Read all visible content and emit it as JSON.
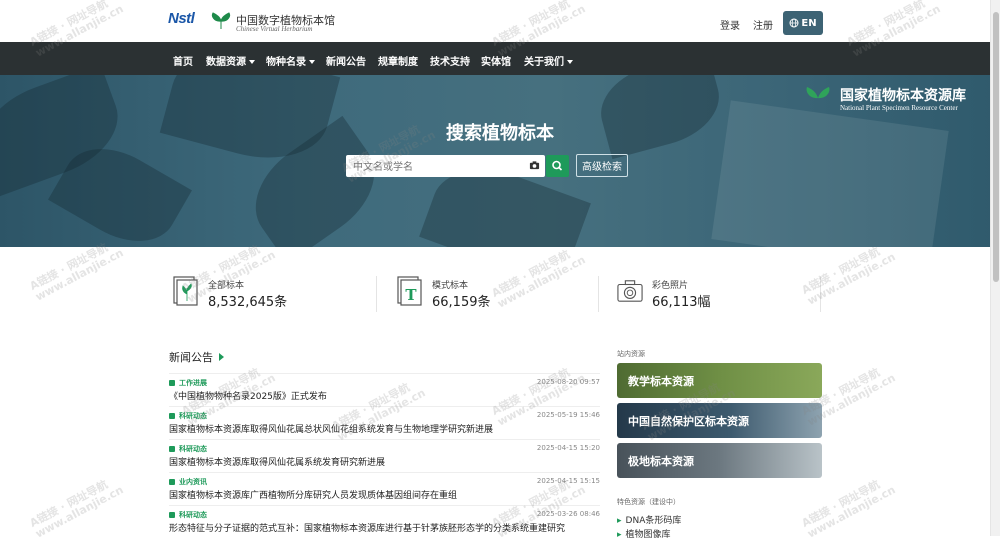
{
  "header": {
    "logo_nstl": "Nstl",
    "logo_cn": "中国数字植物标本馆",
    "logo_en": "Chinese Virtual Herbarium",
    "login": "登录",
    "register": "注册",
    "lang": "EN"
  },
  "nav": {
    "items": [
      {
        "label": "首页",
        "dropdown": false
      },
      {
        "label": "数据资源",
        "dropdown": true
      },
      {
        "label": "物种名录",
        "dropdown": true
      },
      {
        "label": "新闻公告",
        "dropdown": false
      },
      {
        "label": "规章制度",
        "dropdown": false
      },
      {
        "label": "技术支持",
        "dropdown": false
      },
      {
        "label": "实体馆",
        "dropdown": false
      },
      {
        "label": "关于我们",
        "dropdown": true
      }
    ]
  },
  "hero": {
    "title": "搜索植物标本",
    "search_placeholder": "中文名或学名",
    "advanced_label": "高级检索",
    "brand_cn": "国家植物标本资源库",
    "brand_en": "National Plant Specimen Resource Center"
  },
  "stats": [
    {
      "label": "全部标本",
      "value": "8,532,645条",
      "icon": "specimen-icon"
    },
    {
      "label": "模式标本",
      "value": "66,159条",
      "icon": "type-specimen-icon"
    },
    {
      "label": "彩色照片",
      "value": "66,113幅",
      "icon": "camera-icon"
    }
  ],
  "news": {
    "header": "新闻公告",
    "items": [
      {
        "tag": "工作进展",
        "date": "2025-08-20 09:57",
        "title": "《中国植物物种名录2025版》正式发布"
      },
      {
        "tag": "科研动态",
        "date": "2025-05-19 15:46",
        "title": "国家植物标本资源库取得风仙花属总状风仙花组系统发育与生物地理学研究新进展"
      },
      {
        "tag": "科研动态",
        "date": "2025-04-15 15:20",
        "title": "国家植物标本资源库取得风仙花属系统发育研究新进展"
      },
      {
        "tag": "业内资讯",
        "date": "2025-04-15 15:15",
        "title": "国家植物标本资源库广西植物所分库研究人员发现质体基因组间存在重组"
      },
      {
        "tag": "科研动态",
        "date": "2025-03-26 08:46",
        "title": "形态特征与分子证据的范式互补：国家植物标本资源库进行基于针茅族胚形态学的分类系统重建研究"
      }
    ]
  },
  "sidebar": {
    "section_label": "站内资源",
    "cards": [
      {
        "label": "教学标本资源",
        "color": "#5a7a3c"
      },
      {
        "label": "中国自然保护区标本资源",
        "color": "#2f4a5c"
      },
      {
        "label": "极地标本资源",
        "color": "#54606a"
      }
    ],
    "special_label": "特色资源（建设中）",
    "special_items": [
      "DNA条形码库",
      "植物图像库"
    ]
  },
  "watermark": {
    "line1": "A链接 · 网址导航",
    "line2": "www.allanjie.cn"
  }
}
